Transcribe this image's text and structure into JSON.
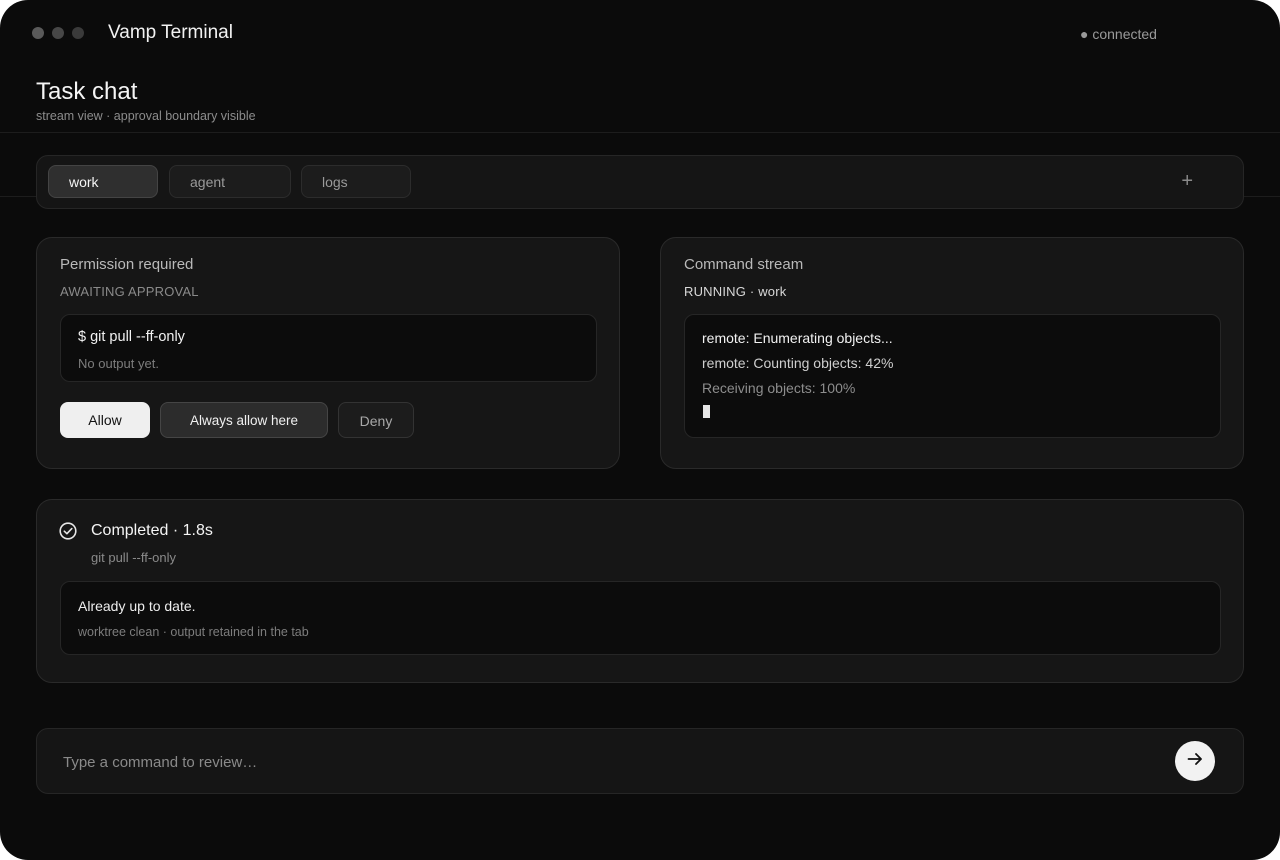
{
  "window": {
    "title": "Vamp Terminal",
    "status": "● connected"
  },
  "header": {
    "title": "Task chat",
    "subtitle": "stream view · approval boundary visible"
  },
  "tabs": [
    {
      "label": "work"
    },
    {
      "label": "agent"
    },
    {
      "label": "logs"
    }
  ],
  "add_tab_symbol": "+",
  "permission": {
    "title": "Permission required",
    "status": "AWAITING APPROVAL",
    "command": "$ git pull --ff-only",
    "output": "No output yet.",
    "buttons": {
      "allow": "Allow",
      "always_allow": "Always allow here",
      "deny": "Deny"
    }
  },
  "stream": {
    "title": "Command stream",
    "status": "RUNNING · work",
    "lines": [
      "remote: Enumerating objects...",
      "remote: Counting objects: 42%",
      "Receiving objects: 100%"
    ]
  },
  "completed": {
    "title": "Completed · 1.8s",
    "command": "git pull --ff-only",
    "result": "Already up to date.",
    "note": "worktree clean · output retained in the tab"
  },
  "input": {
    "placeholder": "Type a command to review…"
  },
  "colors": {
    "background": "#0b0b0b",
    "card": "#161616",
    "accent": "#f2f2f2"
  }
}
